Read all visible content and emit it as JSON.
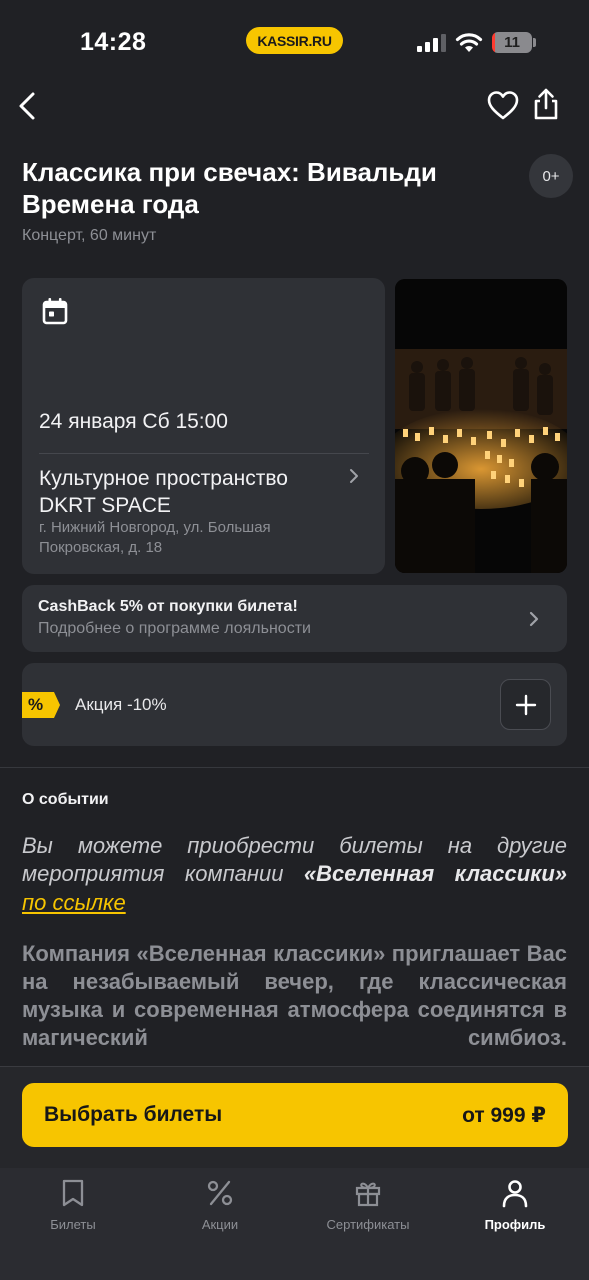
{
  "status_bar": {
    "time": "14:28",
    "brand": "KASSIR.RU",
    "battery": "11"
  },
  "header": {
    "back_icon": "chevron-left-icon",
    "favorite_icon": "heart-icon",
    "share_icon": "share-icon"
  },
  "event": {
    "title": "Классика при свечах: Вивальди Времена года",
    "age_rating": "0+",
    "subtitle": "Концерт, 60 минут",
    "date": "24 января Сб 15:00",
    "venue_name": "Культурное пространство DKRT SPACE",
    "venue_address": "г. Нижний Новгород, ул. Большая Покровская, д. 18"
  },
  "cashback": {
    "title": "CashBack 5% от покупки билета!",
    "subtitle": "Подробнее о программе лояльности"
  },
  "promo": {
    "badge": "%",
    "label": "Акция -10%"
  },
  "about": {
    "heading": "О событии",
    "p1_lead": "Вы можете приобрести билеты на другие мероприятия компании ",
    "p1_bold": "«Вселенная классики»",
    "link": "по ссылке",
    "p2": "Компания «Вселенная классики» приглашает Вас на незабываемый вечер, где классическая музыка и современная атмосфера соединятся в магический симбиоз."
  },
  "buy": {
    "label": "Выбрать билеты",
    "price": "от 999 ₽"
  },
  "tabs": [
    {
      "label": "Билеты",
      "icon": "ticket-bookmark-icon"
    },
    {
      "label": "Акции",
      "icon": "percent-icon"
    },
    {
      "label": "Сертификаты",
      "icon": "gift-icon"
    },
    {
      "label": "Профиль",
      "icon": "profile-icon"
    }
  ],
  "colors": {
    "background": "#202125",
    "card": "#2f3136",
    "accent": "#f7c500",
    "muted_text": "#8d8f95"
  }
}
